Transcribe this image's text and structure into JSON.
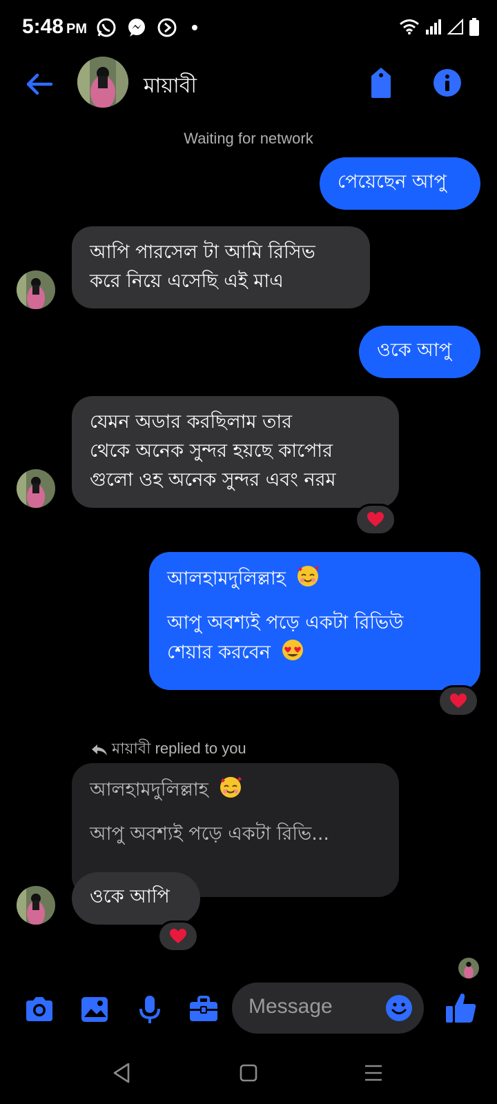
{
  "status_bar": {
    "time": "5:48",
    "ampm": "PM",
    "left_icons": [
      "whatsapp-icon",
      "messenger-icon",
      "navigation-icon"
    ],
    "right_icons": [
      "wifi-icon",
      "signal-icon",
      "signal-empty-icon",
      "battery-icon"
    ]
  },
  "header": {
    "contact_name": "মায়াবী",
    "icons": [
      "back-arrow-icon",
      "tag-icon",
      "info-icon"
    ]
  },
  "network_status": "Waiting for network",
  "messages": [
    {
      "direction": "sent",
      "text": "পেয়েছেন আপু"
    },
    {
      "direction": "received",
      "lines": [
        "আপি পারসেল টা আমি রিসিভ",
        "করে নিয়ে এসেছি এই মাএ"
      ]
    },
    {
      "direction": "sent",
      "text": "ওকে আপু"
    },
    {
      "direction": "received",
      "lines": [
        "যেমন অডার করছিলাম তার",
        "থেকে অনেক সুন্দর হয়ছে কাপোর",
        "গুলো ওহ অনেক সুন্দর এবং নরম"
      ],
      "reaction": "heart"
    },
    {
      "direction": "sent",
      "lines": [
        "আলহামদুলিল্লাহ",
        "আপু অবশ্যই পড়ে একটা রিভিউ",
        "শেয়ার করবেন"
      ],
      "reaction": "heart",
      "emojis": [
        "smiling-face-with-hearts",
        "heart-eyes"
      ]
    },
    {
      "direction": "received",
      "reply_note": "মায়াবী replied to you",
      "quoted_lines": [
        "আলহামদুলিল্লাহ",
        "আপু অবশ্যই পড়ে একটা রিভি..."
      ],
      "text": "ওকে আপি",
      "reaction": "heart"
    }
  ],
  "composer": {
    "placeholder": "Message",
    "icons": [
      "camera-icon",
      "image-icon",
      "microphone-icon",
      "briefcase-icon",
      "emoji-icon",
      "thumbs-up-icon"
    ]
  },
  "colors": {
    "accent": "#1a62ff",
    "received_bubble": "#333336",
    "background": "#000000",
    "reaction_heart": "#e8193c"
  }
}
